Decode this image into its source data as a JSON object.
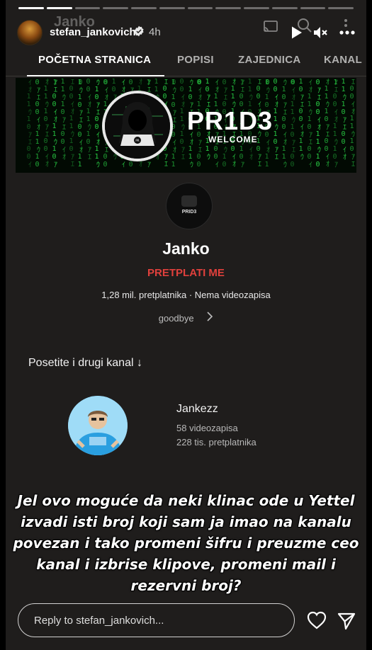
{
  "story": {
    "progress": [
      1,
      1,
      0,
      0,
      0,
      0,
      0,
      0,
      0,
      0,
      0,
      0
    ],
    "ghost_title": "Janko",
    "username": "stefan_jankovich",
    "time": "4h",
    "icons": [
      "cast-icon",
      "search-icon",
      "play-icon",
      "mute-icon",
      "more-icon",
      "verified-icon"
    ]
  },
  "tabs": [
    {
      "label": "POČETNA STRANICA",
      "active": true
    },
    {
      "label": "POPISI",
      "active": false
    },
    {
      "label": "ZAJEDNICA",
      "active": false
    },
    {
      "label": "KANAL",
      "active": false
    }
  ],
  "banner": {
    "logo_text": "PR",
    "title": "PR1D3",
    "subtitle": "WELCOME"
  },
  "channel": {
    "avatar_text": "PRID3",
    "name": "Janko",
    "subscribe_label": "PRETPLATI ME",
    "stats": "1,28 mil. pretplatnika · Nema videozapisa",
    "description": "goodbye"
  },
  "section_title": "Posetite i drugi kanal ↓",
  "featured_channel": {
    "name": "Jankezz",
    "videos": "58 videozapisa",
    "subscribers": "228 tis. pretplatnika"
  },
  "caption": "Jel ovo moguće da neki klinac ode u Yettel izvadi isti broj koji sam ja imao na kanalu povezan i tako promeni šifru i preuzme ceo kanal i izbrise klipove, promeni mail i rezervni broj?",
  "reply": {
    "placeholder": "Reply to stefan_jankovich...",
    "value": ""
  },
  "colors": {
    "accent_red": "#e0403c",
    "matrix_green": "#2ce04a",
    "background": "#1f1d1c"
  }
}
